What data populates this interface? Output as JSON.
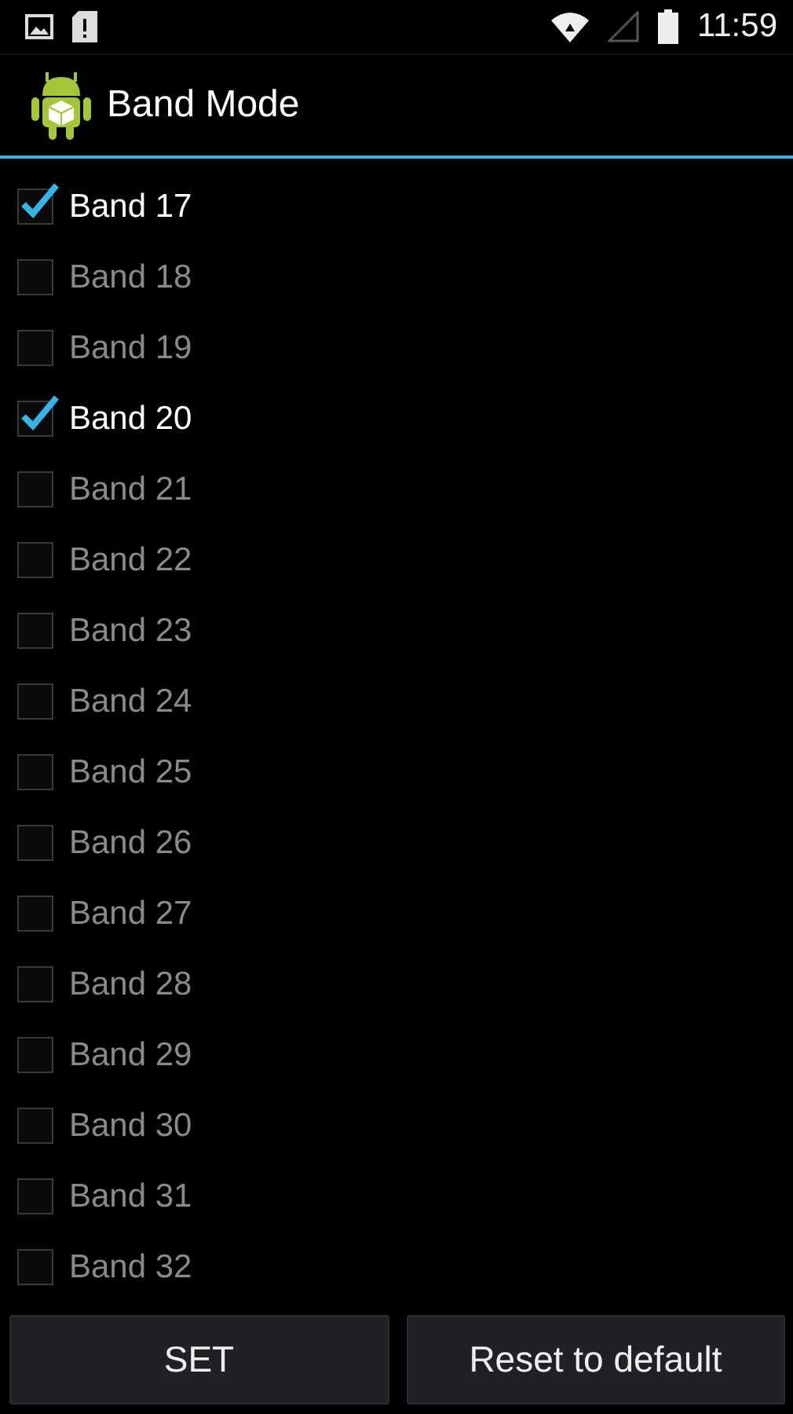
{
  "status_bar": {
    "time": "11:59"
  },
  "action_bar": {
    "title": "Band Mode"
  },
  "bands": [
    {
      "label": "Band 17",
      "checked": true
    },
    {
      "label": "Band 18",
      "checked": false
    },
    {
      "label": "Band 19",
      "checked": false
    },
    {
      "label": "Band 20",
      "checked": true
    },
    {
      "label": "Band 21",
      "checked": false
    },
    {
      "label": "Band 22",
      "checked": false
    },
    {
      "label": "Band 23",
      "checked": false
    },
    {
      "label": "Band 24",
      "checked": false
    },
    {
      "label": "Band 25",
      "checked": false
    },
    {
      "label": "Band 26",
      "checked": false
    },
    {
      "label": "Band 27",
      "checked": false
    },
    {
      "label": "Band 28",
      "checked": false
    },
    {
      "label": "Band 29",
      "checked": false
    },
    {
      "label": "Band 30",
      "checked": false
    },
    {
      "label": "Band 31",
      "checked": false
    },
    {
      "label": "Band 32",
      "checked": false
    }
  ],
  "buttons": [
    "SET",
    "Reset to default"
  ]
}
